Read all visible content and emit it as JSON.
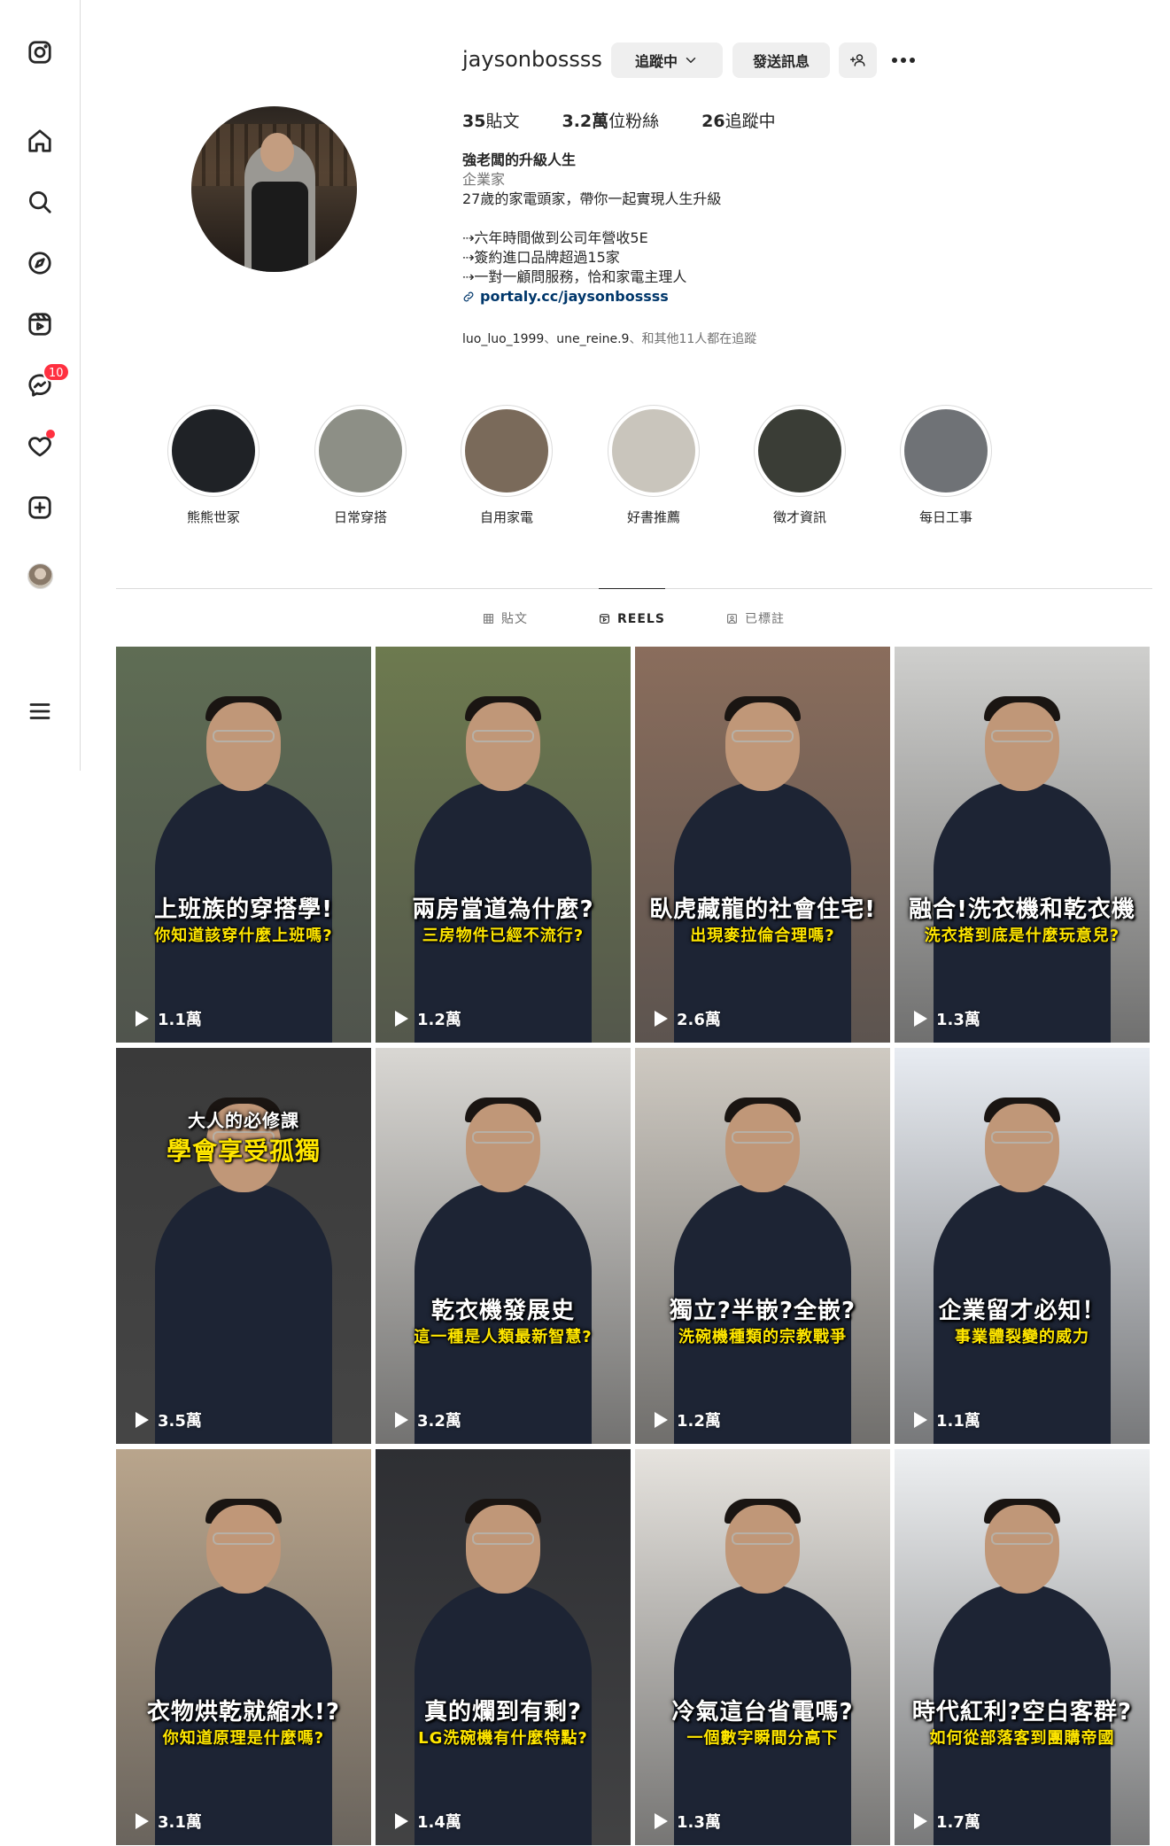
{
  "profile": {
    "username": "jaysonbossss",
    "follow_button": "追蹤中",
    "message_button": "發送訊息",
    "stats": [
      {
        "value": "35",
        "label": "貼文"
      },
      {
        "value": "3.2萬",
        "label": "位粉絲"
      },
      {
        "value": "26",
        "label": "追蹤中"
      }
    ],
    "display_name": "強老闆的升級人生",
    "category": "企業家",
    "bio_line1": "27歲的家電頭家，帶你一起實現人生升級",
    "bio_line2": "⇢六年時間做到公司年營收5E",
    "bio_line3": "⇢簽約進口品牌超過15家",
    "bio_line4": "⇢一對一顧問服務，恰和家電主理人",
    "link": "portaly.cc/jaysonbossss",
    "followed_by_1": "luo_luo_1999",
    "followed_by_sep": "、",
    "followed_by_2": "une_reine.9",
    "followed_by_rest": "、和其他11人都在追蹤"
  },
  "sidebar": {
    "notification_count": "10"
  },
  "highlights": [
    {
      "label": "熊熊世冢",
      "color": "#1f2226"
    },
    {
      "label": "日常穿搭",
      "color": "#8d8f86"
    },
    {
      "label": "自用家電",
      "color": "#7a6a5a"
    },
    {
      "label": "好書推薦",
      "color": "#c9c5bc"
    },
    {
      "label": "徵才資訊",
      "color": "#3a3d36"
    },
    {
      "label": "每日工事",
      "color": "#6f7276"
    }
  ],
  "tabs": [
    {
      "label": "貼文"
    },
    {
      "label": "REELS"
    },
    {
      "label": "已標註"
    }
  ],
  "reels": [
    {
      "title": "上班族的穿搭學!",
      "subtitle": "你知道該穿什麼上班嗎?",
      "views": "1.1萬",
      "bg": "#5f6d54"
    },
    {
      "title": "兩房當道為什麼?",
      "subtitle": "三房物件已經不流行?",
      "views": "1.2萬",
      "bg": "#6d7a4f"
    },
    {
      "title": "臥虎藏龍的社會住宅!",
      "subtitle": "出現麥拉倫合理嗎?",
      "views": "2.6萬",
      "bg": "#8a6d5c"
    },
    {
      "title": "融合!洗衣機和乾衣機",
      "subtitle": "洗衣搭到底是什麼玩意兒?",
      "views": "1.3萬",
      "bg": "#cfcfcd"
    },
    {
      "title": "大人的必修課",
      "subtitle": "學會享受孤獨",
      "views": "3.5萬",
      "bg": "#3a3a3a"
    },
    {
      "title": "乾衣機發展史",
      "subtitle": "這一種是人類最新智慧?",
      "views": "3.2萬",
      "bg": "#d9d7d3"
    },
    {
      "title": "獨立?半嵌?全嵌?",
      "subtitle": "洗碗機種類的宗教戰爭",
      "views": "1.2萬",
      "bg": "#cfcac2"
    },
    {
      "title": "企業留才必知！",
      "subtitle": "事業體裂變的威力",
      "views": "1.1萬",
      "bg": "#e8ecf2"
    },
    {
      "title": "衣物烘乾就縮水!?",
      "subtitle": "你知道原理是什麼嗎?",
      "views": "3.1萬",
      "bg": "#b9a58c"
    },
    {
      "title": "真的爛到有剩?",
      "subtitle": "LG洗碗機有什麼特點?",
      "views": "1.4萬",
      "bg": "#2e2f33"
    },
    {
      "title": "冷氣這台省電嗎?",
      "subtitle": "一個數字瞬間分高下",
      "views": "1.3萬",
      "bg": "#e6e3de"
    },
    {
      "title": "時代紅利?空白客群?",
      "subtitle": "如何從部落客到團購帝國",
      "views": "1.7萬",
      "bg": "#eef0f2"
    }
  ]
}
